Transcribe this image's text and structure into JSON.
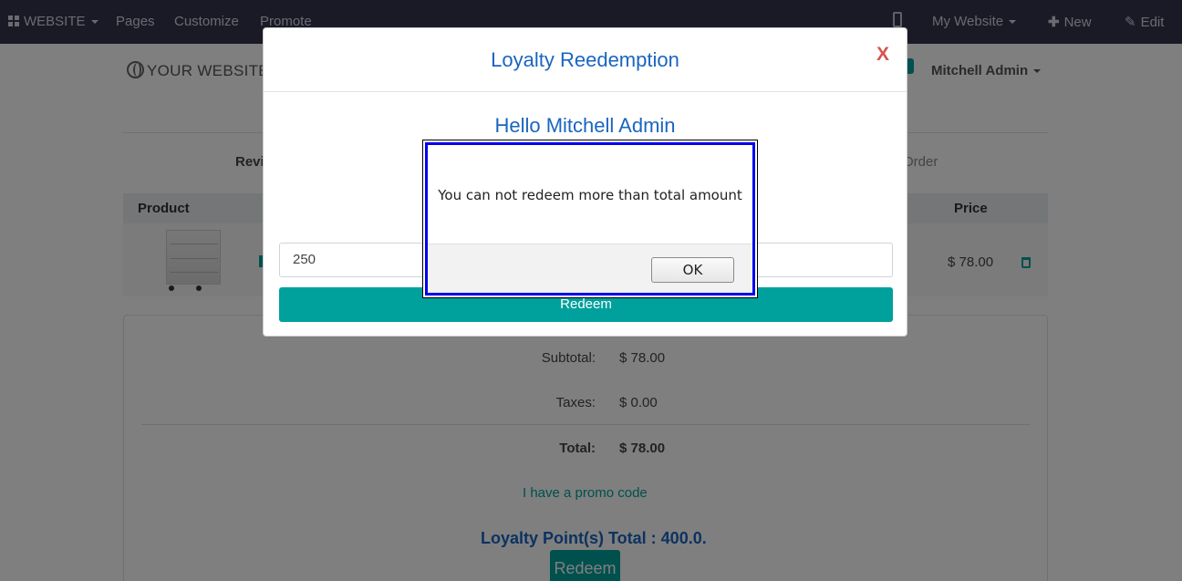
{
  "topbar": {
    "website_menu": "WEBSITE",
    "pages": "Pages",
    "customize": "Customize",
    "promote": "Promote",
    "my_website": "My Website",
    "new": "New",
    "edit": "Edit"
  },
  "header": {
    "logo": "YOUR WEBSITE",
    "user": "Mitchell Admin"
  },
  "checkout": {
    "step_review": "Revi",
    "step_order": "Order",
    "columns": {
      "product": "Product",
      "price": "Price"
    },
    "row": {
      "price": "$ 78.00"
    },
    "summary": {
      "subtotal_label": "Subtotal:",
      "subtotal_value": "$ 78.00",
      "taxes_label": "Taxes:",
      "taxes_value": "$ 0.00",
      "total_label": "Total:",
      "total_value": "$ 78.00"
    },
    "promo_link": "I have a promo code",
    "loyalty_total": "Loyalty Point(s) Total : 400.0.",
    "redeem_button": "Redeem"
  },
  "modal": {
    "title": "Loyalty Reedemption",
    "close": "X",
    "greeting": "Hello Mitchell Admin",
    "points_value": "250",
    "redeem_button": "Redeem"
  },
  "alert": {
    "message": "You can not redeem more than total amount",
    "ok": "OK"
  },
  "colors": {
    "topbar": "#34354f",
    "accent": "#00a09d",
    "title_blue": "#1a65c0",
    "close_red": "#d9534f",
    "alert_focus": "#0000ee"
  }
}
